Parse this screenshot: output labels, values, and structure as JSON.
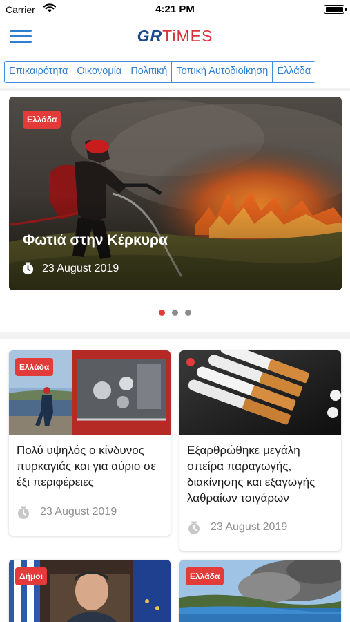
{
  "status_bar": {
    "carrier": "Carrier",
    "time": "4:21 PM"
  },
  "nav": {
    "logo_gr": "GR",
    "logo_times": "TiMES",
    "menu_icon": "hamburger-icon"
  },
  "tabs": [
    {
      "label": "Επικαιρότητα"
    },
    {
      "label": "Οικονομία"
    },
    {
      "label": "Πολιτική"
    },
    {
      "label": "Τοπική Αυτοδιοίκηση"
    },
    {
      "label": "Ελλάδα"
    }
  ],
  "hero": {
    "badge": "Ελλάδα",
    "title": "Φωτιά στην Κέρκυρα",
    "date": "23 August 2019",
    "image": "firefighter-fire-photo"
  },
  "carousel": {
    "pages": 3,
    "active_index": 0
  },
  "articles": [
    {
      "badge": "Ελλάδα",
      "title": "Πολύ υψηλός ο κίνδυνος πυρκαγιάς και για αύριο σε έξι περιφέρειες",
      "date": "23 August 2019",
      "image": "fire-truck-photo"
    },
    {
      "badge": "",
      "title": "Εξαρθρώθηκε μεγάλη σπείρα παραγωγής, διακίνησης και εξαγωγής λαθραίων τσιγάρων",
      "date": "23 August 2019",
      "image": "cigarettes-photo"
    },
    {
      "badge": "Δήμοι",
      "title": "",
      "date": "",
      "image": "mayor-portrait-photo"
    },
    {
      "badge": "Ελλάδα",
      "title": "",
      "date": "",
      "image": "coastal-smoke-photo"
    }
  ],
  "colors": {
    "accent": "#2f7fd0",
    "badge_red": "#e33a3a",
    "logo_blue": "#1d4a8c",
    "logo_red": "#d8323a",
    "date_gray": "#8e8e8e"
  }
}
